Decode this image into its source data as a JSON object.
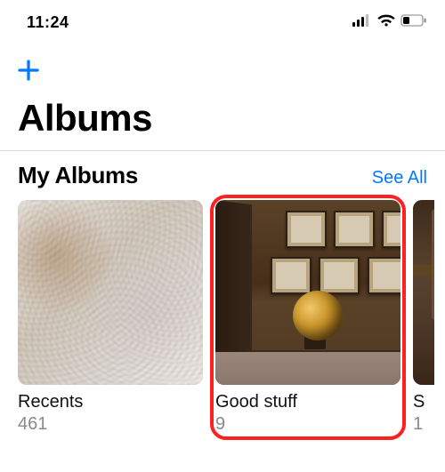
{
  "status_bar": {
    "time": "11:24"
  },
  "header": {
    "add_icon": "plus-icon",
    "title": "Albums"
  },
  "my_albums": {
    "title": "My Albums",
    "see_all": "See All",
    "items": [
      {
        "title": "Recents",
        "count": "461"
      },
      {
        "title": "Good stuff",
        "count": "9",
        "highlighted": true
      },
      {
        "title": "S",
        "count": "1"
      }
    ]
  }
}
